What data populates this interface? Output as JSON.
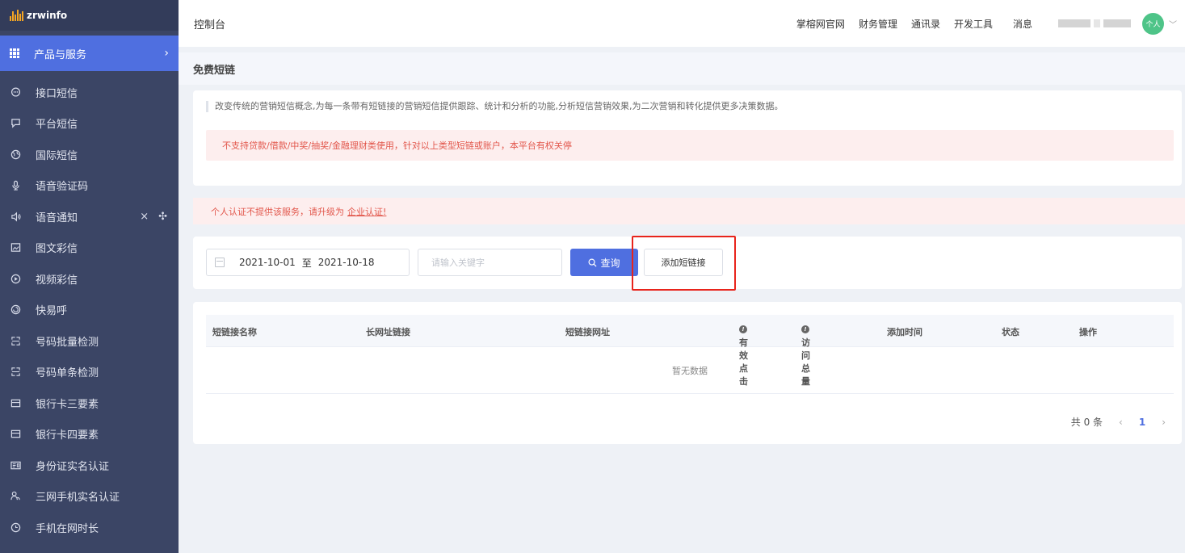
{
  "app": {
    "logo_text": "zrwinfo"
  },
  "sidebar": {
    "product_label": "产品与服务",
    "items": [
      {
        "label": "接口短信",
        "icon": "chat-icon"
      },
      {
        "label": "平台短信",
        "icon": "message-icon"
      },
      {
        "label": "国际短信",
        "icon": "globe-icon"
      },
      {
        "label": "语音验证码",
        "icon": "microphone-icon"
      },
      {
        "label": "语音通知",
        "icon": "speaker-icon",
        "extra": [
          "×",
          "✣"
        ]
      },
      {
        "label": "图文彩信",
        "icon": "image-icon"
      },
      {
        "label": "视频彩信",
        "icon": "play-icon"
      },
      {
        "label": "快易呼",
        "icon": "swirl-icon"
      },
      {
        "label": "号码批量检测",
        "icon": "scan-icon"
      },
      {
        "label": "号码单条检测",
        "icon": "scan-single-icon"
      },
      {
        "label": "银行卡三要素",
        "icon": "card-icon"
      },
      {
        "label": "银行卡四要素",
        "icon": "card4-icon"
      },
      {
        "label": "身份证实名认证",
        "icon": "id-card-icon"
      },
      {
        "label": "三网手机实名认证",
        "icon": "users-icon"
      },
      {
        "label": "手机在网时长",
        "icon": "clock-icon"
      }
    ]
  },
  "header": {
    "title": "控制台",
    "links": [
      "掌榕网官网",
      "财务管理",
      "通讯录",
      "开发工具"
    ],
    "message": "消息",
    "avatar_text": "个人"
  },
  "page": {
    "title": "免费短链",
    "description": "改变传统的营销短信概念,为每一条带有短链接的营销短信提供跟踪、统计和分析的功能,分析短信营销效果,为二次营销和转化提供更多决策数据。",
    "warning": "不支持贷款/借款/中奖/抽奖/金融理财类使用，针对以上类型短链或账户，本平台有权关停",
    "auth_notice": "个人认证不提供该服务，请升级为",
    "auth_link": "企业认证!"
  },
  "filter": {
    "date_start": "2021-10-01",
    "date_sep": "至",
    "date_end": "2021-10-18",
    "keyword_placeholder": "请输入关键字",
    "search_label": "查询",
    "add_label": "添加短链接"
  },
  "table": {
    "columns": [
      "短链接名称",
      "长网址链接",
      "短链接网址",
      "有效点击",
      "访问总量",
      "添加时间",
      "状态",
      "操作"
    ],
    "empty_text": "暂无数据"
  },
  "pagination": {
    "total_text": "共 0 条",
    "current_page": "1",
    "prev": "‹",
    "next": "›"
  },
  "colors": {
    "sidebar_bg": "#3b4565",
    "accent": "#4f6fe0",
    "warning": "#e2574c",
    "highlight": "#e8241b"
  }
}
